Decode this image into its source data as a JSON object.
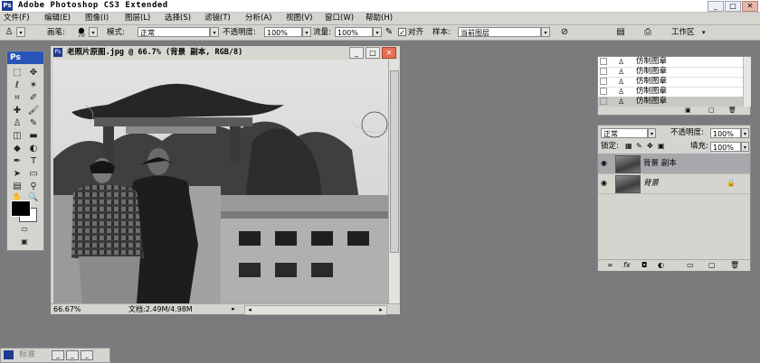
{
  "app": {
    "title": "Adobe Photoshop CS3 Extended",
    "min_label": "_",
    "max_label": "□",
    "close_label": "✕"
  },
  "menu": [
    "文件(F)",
    "编辑(E)",
    "图像(I)",
    "图层(L)",
    "选择(S)",
    "滤镜(T)",
    "分析(A)",
    "视图(V)",
    "窗口(W)",
    "帮助(H)"
  ],
  "options": {
    "brush_label": "画笔:",
    "brush_size": "70",
    "mode_label": "模式:",
    "mode_value": "正常",
    "opacity_label": "不透明度:",
    "opacity_value": "100%",
    "flow_label": "流量:",
    "flow_value": "100%",
    "aligned_label": "对齐",
    "sample_label": "样本:",
    "sample_value": "当前图层",
    "workspace_label": "工作区",
    "check_mark": "✓",
    "dropdown_arrow": "▾"
  },
  "toolbox": {
    "logo": "Ps"
  },
  "document": {
    "title": "老照片原图.jpg @ 66.7% (背景 副本, RGB/8)",
    "logo": "Ps",
    "zoom": "66.67%",
    "doc_info": "文档:2.49M/4.98M",
    "arrow_right": "▸",
    "arrow_left": "◂"
  },
  "history": {
    "items": [
      {
        "label": "仿制图章"
      },
      {
        "label": "仿制图章"
      },
      {
        "label": "仿制图章"
      },
      {
        "label": "仿制图章"
      },
      {
        "label": "仿制图章"
      }
    ]
  },
  "layers": {
    "blend_mode": "正常",
    "opacity_label": "不透明度:",
    "opacity_value": "100%",
    "lock_label": "锁定:",
    "fill_label": "填充:",
    "fill_value": "100%",
    "items": [
      {
        "name": "背景 副本"
      },
      {
        "name": "背景"
      }
    ],
    "eye": "◉",
    "lock": "🔒"
  },
  "taskbar": {
    "label": "标准"
  },
  "colors": {
    "accent": "#2a55b8",
    "bg": "#7b7a7d",
    "panel": "#d5d4cf"
  }
}
